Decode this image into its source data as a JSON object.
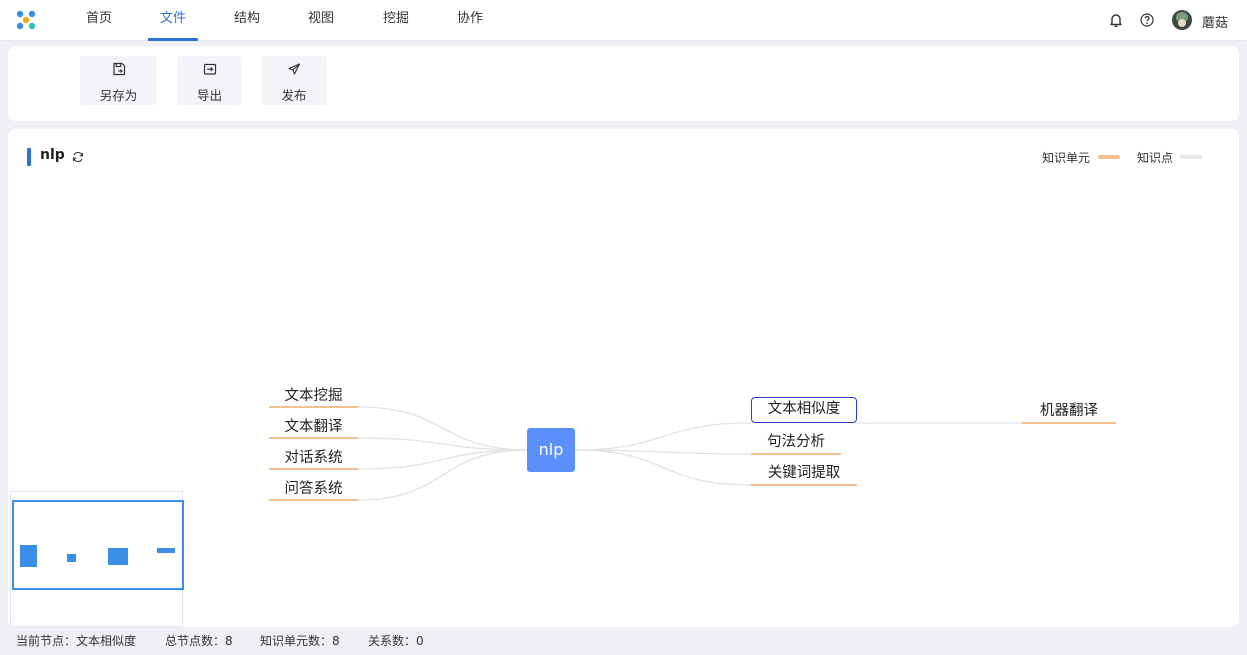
{
  "nav": {
    "logo": "app-logo",
    "tabs": [
      {
        "label": "首页"
      },
      {
        "label": "文件"
      },
      {
        "label": "结构"
      },
      {
        "label": "视图"
      },
      {
        "label": "挖掘"
      },
      {
        "label": "协作"
      }
    ],
    "active_tab": "文件",
    "username": "蘑菇",
    "icons": [
      "bell-icon",
      "help-icon",
      "avatar"
    ]
  },
  "toolbar": {
    "buttons": [
      {
        "label": "另存为",
        "icon": "save-as-icon"
      },
      {
        "label": "导出",
        "icon": "export-icon"
      },
      {
        "label": "发布",
        "icon": "publish-icon"
      }
    ]
  },
  "map": {
    "title": "nlp",
    "legend": [
      {
        "label": "知识单元",
        "color": "#f5c18a"
      },
      {
        "label": "知识点",
        "color": "#e8e8ec"
      }
    ],
    "root": "nlp",
    "left_topics": [
      "文本挖掘",
      "文本翻译",
      "对话系统",
      "问答系统"
    ],
    "right_topics": [
      "文本相似度",
      "句法分析",
      "关键词提取"
    ],
    "sub_topic": "机器翻译",
    "selected": "文本相似度"
  },
  "status": {
    "current_node_label": "当前节点：文本相似度",
    "total_nodes_label": "总节点数：8",
    "knowledge_units_label": "知识单元数：8",
    "relations_label": "关系数：0"
  },
  "colors": {
    "accent": "#2f6fd8",
    "root_node": "#5b8ff9",
    "knowledge_unit_line": "#f5c18a",
    "selected_border": "#3040c8",
    "minimap": "#3a8ee6"
  }
}
